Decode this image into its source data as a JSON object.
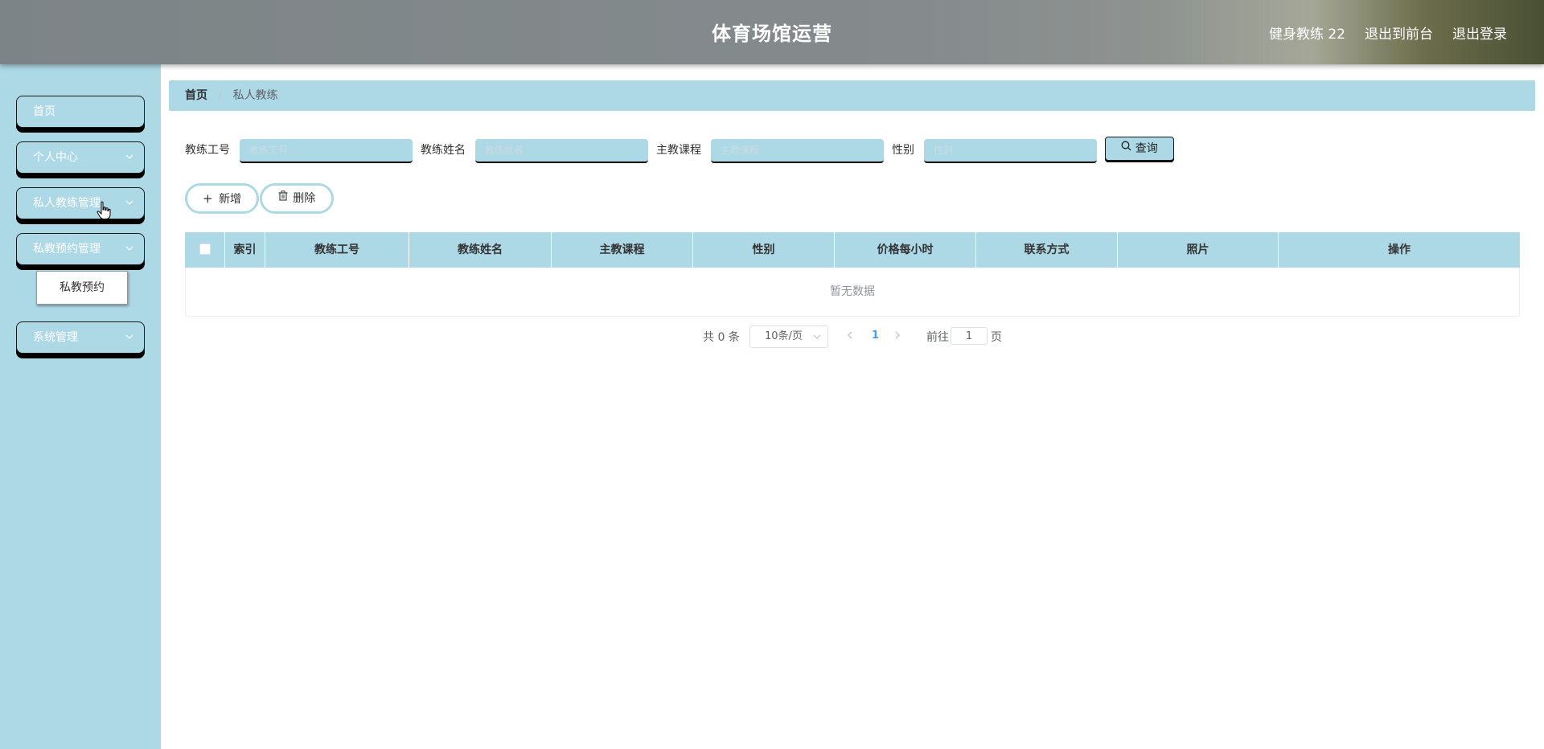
{
  "header": {
    "title": "体育场馆运营",
    "user": "健身教练 22",
    "nav_frontend": "退出到前台",
    "nav_logout": "退出登录"
  },
  "sidebar": {
    "items": [
      {
        "label": "首页"
      },
      {
        "label": "个人中心"
      },
      {
        "label": "私人教练管理"
      },
      {
        "label": "私教预约管理"
      },
      {
        "label": "系统管理"
      }
    ],
    "submenu_item": "私教预约"
  },
  "breadcrumb": {
    "home": "首页",
    "current": "私人教练"
  },
  "search": {
    "fields": [
      {
        "label": "教练工号",
        "placeholder": "教练工号",
        "value": ""
      },
      {
        "label": "教练姓名",
        "placeholder": "教练姓名",
        "value": ""
      },
      {
        "label": "主教课程",
        "placeholder": "主教课程",
        "value": ""
      },
      {
        "label": "性别",
        "placeholder": "性别",
        "value": ""
      }
    ],
    "button": "查询"
  },
  "actions": {
    "add": "新增",
    "delete": "删除"
  },
  "table": {
    "columns": [
      "索引",
      "教练工号",
      "教练姓名",
      "主教课程",
      "性别",
      "价格每小时",
      "联系方式",
      "照片",
      "操作"
    ],
    "empty_text": "暂无数据"
  },
  "pagination": {
    "total": "共 0 条",
    "page_size": "10条/页",
    "current_page": "1",
    "goto_label": "前往",
    "goto_value": "1",
    "page_suffix": "页"
  },
  "colors": {
    "accent": "#add8e6",
    "header_bg": "#858b8d",
    "link_active": "#409eff"
  }
}
